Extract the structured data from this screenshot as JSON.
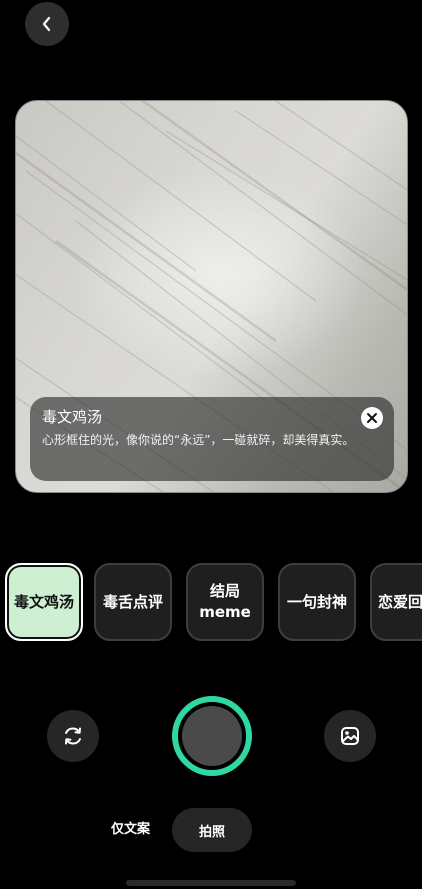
{
  "caption": {
    "title": "毒文鸡汤",
    "text": "心形框住的光，像你说的“永远”，一碰就碎，却美得真实。"
  },
  "styles": [
    {
      "label": "毒文鸡汤",
      "active": true
    },
    {
      "label": "毒舌点评",
      "active": false
    },
    {
      "label": "结局\nmeme",
      "active": false
    },
    {
      "label": "一句封神",
      "active": false
    },
    {
      "label": "恋爱回",
      "active": false
    }
  ],
  "modes": {
    "copy_only": "仅文案",
    "take_photo": "拍照"
  },
  "icons": {
    "back": "chevron-left-icon",
    "close": "close-icon",
    "flip": "flip-camera-icon",
    "gallery": "gallery-icon"
  },
  "colors": {
    "shutter_ring": "#2ed7a4",
    "active_chip": "#cfefd3"
  }
}
